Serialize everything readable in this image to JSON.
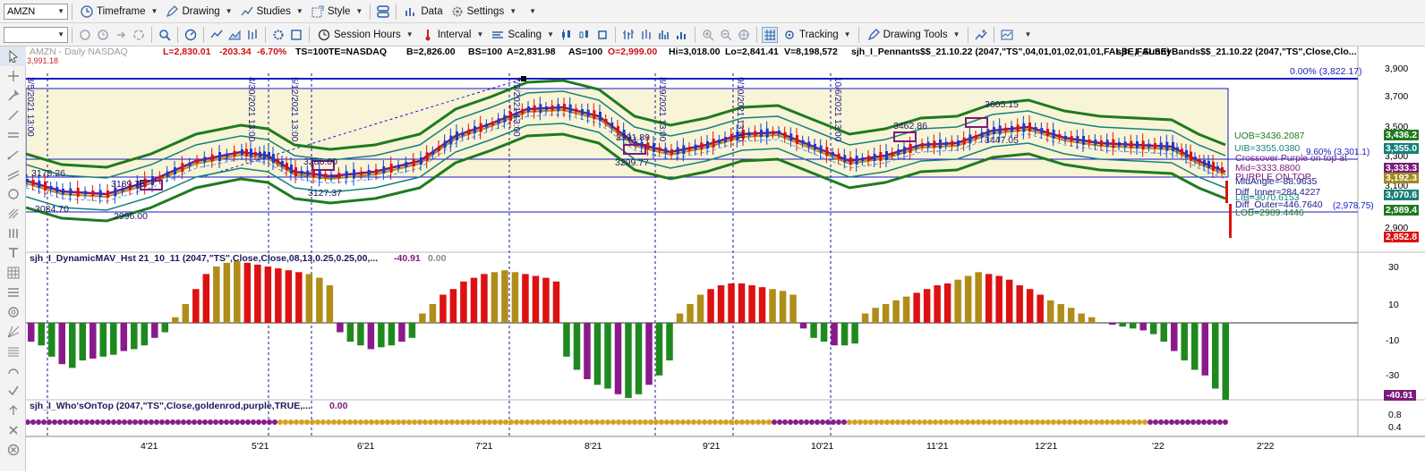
{
  "toolbar1": {
    "symbol": "AMZN",
    "items": [
      "Timeframe",
      "Drawing",
      "Studies",
      "Style",
      "Data",
      "Settings"
    ]
  },
  "toolbar2": {
    "combo_value": "",
    "session_hours": "Session Hours",
    "interval": "Interval",
    "scaling": "Scaling",
    "tracking": "Tracking",
    "drawing_tools": "Drawing Tools"
  },
  "header": {
    "symbol_info": "AMZN - Daily  NASDAQ",
    "last": "L=2,830.01",
    "change": "-203.34",
    "pct": "-6.70%",
    "ts": "TS=100",
    "te": "TE=NASDAQ",
    "bid": "B=2,826.00",
    "bs": "BS=100",
    "ask": "A=2,831.98",
    "as": "AS=100",
    "open": "O=2,999.00",
    "hi": "Hi=3,018.00",
    "lo": "Lo=2,841.41",
    "vol": "V=8,198,572",
    "study1": "sjh_I_Pennants$$_21.10.22 (2047,\"TS\",04,01,01,02,01,01,FALSE,FALSE)",
    "study2": "sjh_I_SunnyBands$$_21.10.22 (2047,\"TS\",Close,Clo...",
    "hidden_value": "3,991.18"
  },
  "price_axis": {
    "ticks": [
      "3,900",
      "3,700",
      "3,500",
      "3,300",
      "3,100",
      "2,900"
    ],
    "markers": [
      {
        "text": "3,436.2",
        "color": "#1e7a1e"
      },
      {
        "text": "3,355.0",
        "color": "#17807a"
      },
      {
        "text": "3,333.3",
        "color": "#7b1b7b"
      },
      {
        "text": "3,192.3",
        "color": "#a08a1a"
      },
      {
        "text": "3,070.6",
        "color": "#17807a"
      },
      {
        "text": "2,989.4",
        "color": "#1e7a1e"
      },
      {
        "text": "2,852.8",
        "color": "#dd1111"
      }
    ]
  },
  "fib": {
    "top": "0.00% (3,822.17)",
    "mid": "9.60% (3,301.1)",
    "bottom": "(2,978.75)"
  },
  "band_labels": {
    "uob": "UOB=3436.2087",
    "uib": "UIB=3355.0380",
    "crossover": "Crossover Purple on top at",
    "mid": "Mid=3333.8800",
    "purple_top": "PURPLE ON TOP",
    "midangle": "MidAngle=-88.9635",
    "diff_inner": "Diff_Inner=284.4227",
    "lib": "LIB=3070.6153",
    "diff_outer": "Diff_Outer=446.7640",
    "lob": "LOB=2989.4446"
  },
  "annotations": [
    "3178.26",
    "3189.76",
    "3084.70",
    "2996.00",
    "3286.00",
    "3127.37",
    "3391.89",
    "3299.77",
    "3462.86",
    "3605.15",
    "3447.05"
  ],
  "date_labels": [
    "3/5/2021 13:00",
    "4/30/2021 13:00",
    "5/12/2021 13:00",
    "7/9/2021 13:00",
    "8/19/2021 13:00",
    "9/10/2021 13:00",
    "10/6/2021 13:00"
  ],
  "pane2": {
    "title": "sjh_I_DynamicMAV_Hst 21_10_11 (2047,\"TS\",Close,Close,08,13,0.25,0.25,00,...",
    "v1": "-40.91",
    "v2": "0.00",
    "ticks": [
      "30",
      "10",
      "-10",
      "-30"
    ],
    "marker": "-40.91"
  },
  "pane3": {
    "title": "sjh_I_Who'sOnTop (2047,\"TS\",Close,goldenrod,purple,TRUE,...",
    "v1": "0.00",
    "ticks": [
      "0.8",
      "0.4"
    ]
  },
  "x_axis": [
    "4'21",
    "5'21",
    "6'21",
    "7'21",
    "8'21",
    "9'21",
    "10'21",
    "11'21",
    "12'21",
    "'22",
    "2'22"
  ],
  "chart_data": {
    "type": "table",
    "histogram_series": {
      "name": "sjh_I_DynamicMAV_Hst",
      "values": [
        -10,
        -12,
        -18,
        -22,
        -24,
        -20,
        -19,
        -18,
        -17,
        -15,
        -14,
        -12,
        -8,
        -5,
        3,
        10,
        18,
        26,
        30,
        32,
        33,
        32,
        31,
        30,
        29,
        28,
        27,
        26,
        24,
        20,
        -5,
        -10,
        -12,
        -14,
        -13,
        -12,
        -10,
        -8,
        5,
        10,
        15,
        18,
        22,
        24,
        26,
        27,
        28,
        27,
        26,
        25,
        24,
        22,
        -18,
        -25,
        -30,
        -33,
        -35,
        -38,
        -40,
        -38,
        -33,
        -28,
        -20,
        5,
        10,
        15,
        18,
        20,
        21,
        21,
        20,
        19,
        18,
        17,
        15,
        -3,
        -8,
        -10,
        -12,
        -12,
        -11,
        5,
        8,
        10,
        12,
        14,
        16,
        18,
        20,
        21,
        23,
        25,
        27,
        26,
        25,
        23,
        20,
        18,
        15,
        12,
        10,
        8,
        5,
        3,
        0,
        -1,
        -2,
        -3,
        -4,
        -6,
        -10,
        -15,
        -20,
        -25,
        -28,
        -35,
        -41
      ]
    },
    "whos_on_top": {
      "name": "sjh_I_Who'sOnTop",
      "segments": [
        {
          "color": "purple",
          "from": 0,
          "to": 0.21
        },
        {
          "color": "goldenrod",
          "from": 0.21,
          "to": 0.62
        },
        {
          "color": "purple",
          "from": 0.62,
          "to": 0.68
        },
        {
          "color": "goldenrod",
          "from": 0.68,
          "to": 0.93
        },
        {
          "color": "purple",
          "from": 0.93,
          "to": 1
        }
      ]
    }
  }
}
